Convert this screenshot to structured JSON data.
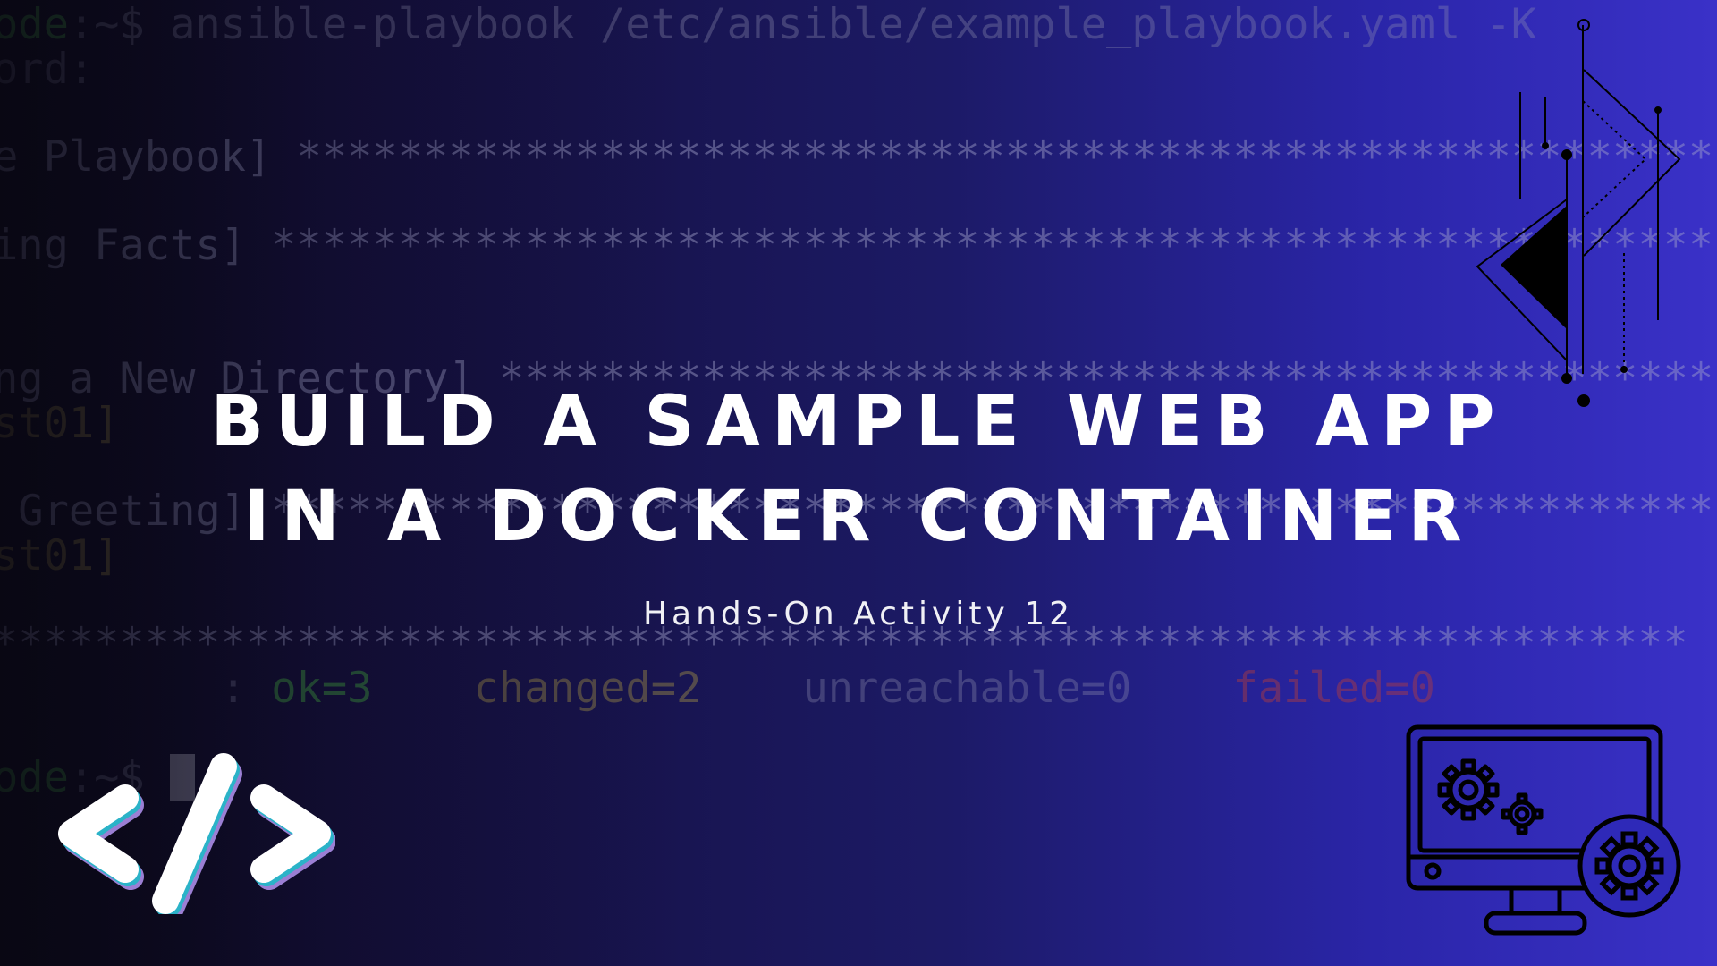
{
  "terminal": {
    "lines": [
      {
        "prompt_host": "ode",
        "prompt_rest": ":~$ ",
        "command": "ansible-playbook /etc/ansible/example_playbook.yaml -K"
      },
      {
        "text": "ord:"
      },
      {
        "text": "e Playbook] ",
        "stars": "*********************************************************"
      },
      {
        "text": "ing Facts] ",
        "stars": "**********************************************************"
      },
      {
        "text": "ng a New Directory] ",
        "stars": "*****************************************************"
      },
      {
        "text": "st01]"
      },
      {
        "text": " Greeting] ",
        "stars": "**********************************************************"
      },
      {
        "text": "st01]"
      },
      {
        "text": "",
        "stars": "*******************************************************************"
      },
      {
        "recap_host": "         : ",
        "ok": "ok=3",
        "changed": "changed=2",
        "unreachable": "unreachable=0",
        "failed": "failed=0"
      },
      {
        "prompt_host": "ode",
        "prompt_rest": ":~$ "
      }
    ]
  },
  "title": {
    "line1": "BUILD A SAMPLE WEB APP",
    "line2": "IN A DOCKER CONTAINER"
  },
  "subtitle": "Hands-On Activity 12",
  "icons": {
    "code": "code-brackets-icon",
    "arrow": "geometric-arrow-icon",
    "monitor": "monitor-gears-icon"
  },
  "colors": {
    "title": "#ffffff",
    "background_start": "#0b0a16",
    "background_end": "#3a31c8",
    "icon_teal": "#2bb3c8",
    "icon_purple": "#9b7fd4"
  }
}
